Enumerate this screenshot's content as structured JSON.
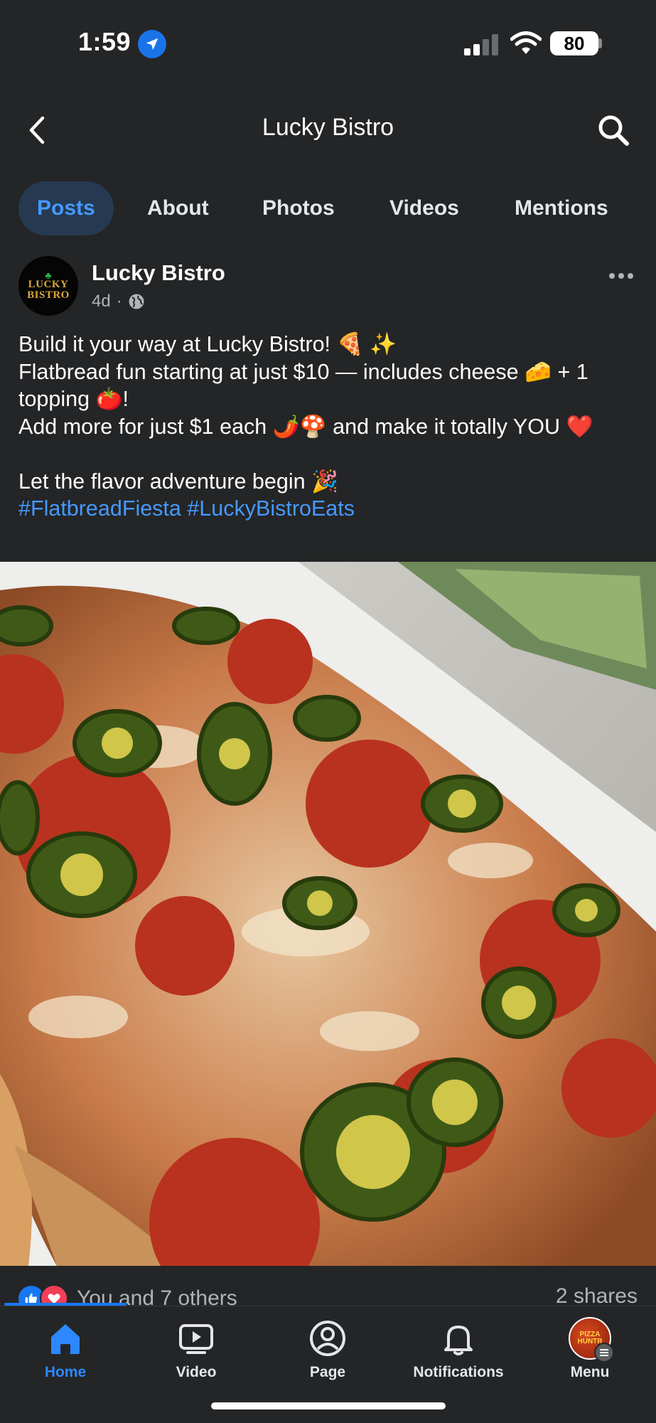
{
  "status_bar": {
    "time": "1:59",
    "battery": "80",
    "icons": [
      "location-arrow-icon",
      "cellular-signal-icon",
      "wifi-icon",
      "battery-icon"
    ]
  },
  "header": {
    "title": "Lucky Bistro",
    "back_icon": "chevron-left-icon",
    "search_icon": "search-icon"
  },
  "tabs": [
    {
      "label": "Posts",
      "active": true
    },
    {
      "label": "About"
    },
    {
      "label": "Photos"
    },
    {
      "label": "Videos"
    },
    {
      "label": "Mentions"
    }
  ],
  "post": {
    "author": "Lucky Bistro",
    "avatar_text": [
      "LUCKY",
      "BISTRO"
    ],
    "time": "4d",
    "separator": "·",
    "audience_icon": "globe-icon",
    "more_icon": "more-dots-icon",
    "caption": [
      "Build it your way at Lucky Bistro! 🍕 ✨",
      "Flatbread fun starting at just $10 — includes cheese 🧀 + 1 topping 🍅!",
      "Add more for just $1 each 🌶️🍄 and make it totally YOU ❤️",
      "",
      "Let the flavor adventure begin 🎉"
    ],
    "hashtags": "#FlatbreadFiesta #LuckyBistroEats",
    "reactions_text": "You and 7 others",
    "shares_text": "2 shares",
    "reaction_icons": [
      "like-reaction-icon",
      "love-reaction-icon"
    ]
  },
  "bottom_nav": [
    {
      "label": "Home",
      "icon": "home-icon",
      "active": true
    },
    {
      "label": "Video",
      "icon": "video-icon"
    },
    {
      "label": "Page",
      "icon": "profile-icon"
    },
    {
      "label": "Notifications",
      "icon": "bell-icon"
    },
    {
      "label": "Menu",
      "icon": "menu-avatar-icon",
      "avatar_text": "PIZZA HUNTR"
    }
  ],
  "colors": {
    "background": "#242526",
    "accent": "#4599ff",
    "active_tab_bg": "#263951",
    "like": "#1877f2",
    "love": "#f33e58"
  }
}
